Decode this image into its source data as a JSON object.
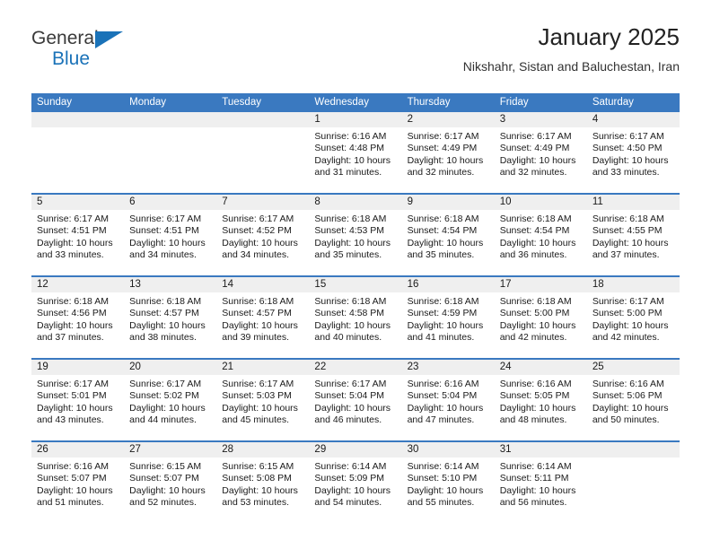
{
  "brand": {
    "name_top": "General",
    "name_bottom": "Blue",
    "logo_color": "#1a72b8",
    "text_color": "#3a3a3a"
  },
  "header": {
    "title": "January 2025",
    "subtitle": "Nikshahr, Sistan and Baluchestan, Iran"
  },
  "theme": {
    "header_bg": "#3a79c0",
    "header_text": "#ffffff",
    "number_band_bg": "#efefef",
    "cell_bg": "#ffffff",
    "divider": "#3a79c0"
  },
  "calendar": {
    "weekdays": [
      "Sunday",
      "Monday",
      "Tuesday",
      "Wednesday",
      "Thursday",
      "Friday",
      "Saturday"
    ],
    "labels": {
      "sunrise": "Sunrise:",
      "sunset": "Sunset:",
      "daylight": "Daylight:"
    },
    "weeks": [
      [
        {
          "day": "",
          "sunrise": "",
          "sunset": "",
          "daylight_line1": "",
          "daylight_line2": ""
        },
        {
          "day": "",
          "sunrise": "",
          "sunset": "",
          "daylight_line1": "",
          "daylight_line2": ""
        },
        {
          "day": "",
          "sunrise": "",
          "sunset": "",
          "daylight_line1": "",
          "daylight_line2": ""
        },
        {
          "day": "1",
          "sunrise": "Sunrise: 6:16 AM",
          "sunset": "Sunset: 4:48 PM",
          "daylight_line1": "Daylight: 10 hours",
          "daylight_line2": "and 31 minutes."
        },
        {
          "day": "2",
          "sunrise": "Sunrise: 6:17 AM",
          "sunset": "Sunset: 4:49 PM",
          "daylight_line1": "Daylight: 10 hours",
          "daylight_line2": "and 32 minutes."
        },
        {
          "day": "3",
          "sunrise": "Sunrise: 6:17 AM",
          "sunset": "Sunset: 4:49 PM",
          "daylight_line1": "Daylight: 10 hours",
          "daylight_line2": "and 32 minutes."
        },
        {
          "day": "4",
          "sunrise": "Sunrise: 6:17 AM",
          "sunset": "Sunset: 4:50 PM",
          "daylight_line1": "Daylight: 10 hours",
          "daylight_line2": "and 33 minutes."
        }
      ],
      [
        {
          "day": "5",
          "sunrise": "Sunrise: 6:17 AM",
          "sunset": "Sunset: 4:51 PM",
          "daylight_line1": "Daylight: 10 hours",
          "daylight_line2": "and 33 minutes."
        },
        {
          "day": "6",
          "sunrise": "Sunrise: 6:17 AM",
          "sunset": "Sunset: 4:51 PM",
          "daylight_line1": "Daylight: 10 hours",
          "daylight_line2": "and 34 minutes."
        },
        {
          "day": "7",
          "sunrise": "Sunrise: 6:17 AM",
          "sunset": "Sunset: 4:52 PM",
          "daylight_line1": "Daylight: 10 hours",
          "daylight_line2": "and 34 minutes."
        },
        {
          "day": "8",
          "sunrise": "Sunrise: 6:18 AM",
          "sunset": "Sunset: 4:53 PM",
          "daylight_line1": "Daylight: 10 hours",
          "daylight_line2": "and 35 minutes."
        },
        {
          "day": "9",
          "sunrise": "Sunrise: 6:18 AM",
          "sunset": "Sunset: 4:54 PM",
          "daylight_line1": "Daylight: 10 hours",
          "daylight_line2": "and 35 minutes."
        },
        {
          "day": "10",
          "sunrise": "Sunrise: 6:18 AM",
          "sunset": "Sunset: 4:54 PM",
          "daylight_line1": "Daylight: 10 hours",
          "daylight_line2": "and 36 minutes."
        },
        {
          "day": "11",
          "sunrise": "Sunrise: 6:18 AM",
          "sunset": "Sunset: 4:55 PM",
          "daylight_line1": "Daylight: 10 hours",
          "daylight_line2": "and 37 minutes."
        }
      ],
      [
        {
          "day": "12",
          "sunrise": "Sunrise: 6:18 AM",
          "sunset": "Sunset: 4:56 PM",
          "daylight_line1": "Daylight: 10 hours",
          "daylight_line2": "and 37 minutes."
        },
        {
          "day": "13",
          "sunrise": "Sunrise: 6:18 AM",
          "sunset": "Sunset: 4:57 PM",
          "daylight_line1": "Daylight: 10 hours",
          "daylight_line2": "and 38 minutes."
        },
        {
          "day": "14",
          "sunrise": "Sunrise: 6:18 AM",
          "sunset": "Sunset: 4:57 PM",
          "daylight_line1": "Daylight: 10 hours",
          "daylight_line2": "and 39 minutes."
        },
        {
          "day": "15",
          "sunrise": "Sunrise: 6:18 AM",
          "sunset": "Sunset: 4:58 PM",
          "daylight_line1": "Daylight: 10 hours",
          "daylight_line2": "and 40 minutes."
        },
        {
          "day": "16",
          "sunrise": "Sunrise: 6:18 AM",
          "sunset": "Sunset: 4:59 PM",
          "daylight_line1": "Daylight: 10 hours",
          "daylight_line2": "and 41 minutes."
        },
        {
          "day": "17",
          "sunrise": "Sunrise: 6:18 AM",
          "sunset": "Sunset: 5:00 PM",
          "daylight_line1": "Daylight: 10 hours",
          "daylight_line2": "and 42 minutes."
        },
        {
          "day": "18",
          "sunrise": "Sunrise: 6:17 AM",
          "sunset": "Sunset: 5:00 PM",
          "daylight_line1": "Daylight: 10 hours",
          "daylight_line2": "and 42 minutes."
        }
      ],
      [
        {
          "day": "19",
          "sunrise": "Sunrise: 6:17 AM",
          "sunset": "Sunset: 5:01 PM",
          "daylight_line1": "Daylight: 10 hours",
          "daylight_line2": "and 43 minutes."
        },
        {
          "day": "20",
          "sunrise": "Sunrise: 6:17 AM",
          "sunset": "Sunset: 5:02 PM",
          "daylight_line1": "Daylight: 10 hours",
          "daylight_line2": "and 44 minutes."
        },
        {
          "day": "21",
          "sunrise": "Sunrise: 6:17 AM",
          "sunset": "Sunset: 5:03 PM",
          "daylight_line1": "Daylight: 10 hours",
          "daylight_line2": "and 45 minutes."
        },
        {
          "day": "22",
          "sunrise": "Sunrise: 6:17 AM",
          "sunset": "Sunset: 5:04 PM",
          "daylight_line1": "Daylight: 10 hours",
          "daylight_line2": "and 46 minutes."
        },
        {
          "day": "23",
          "sunrise": "Sunrise: 6:16 AM",
          "sunset": "Sunset: 5:04 PM",
          "daylight_line1": "Daylight: 10 hours",
          "daylight_line2": "and 47 minutes."
        },
        {
          "day": "24",
          "sunrise": "Sunrise: 6:16 AM",
          "sunset": "Sunset: 5:05 PM",
          "daylight_line1": "Daylight: 10 hours",
          "daylight_line2": "and 48 minutes."
        },
        {
          "day": "25",
          "sunrise": "Sunrise: 6:16 AM",
          "sunset": "Sunset: 5:06 PM",
          "daylight_line1": "Daylight: 10 hours",
          "daylight_line2": "and 50 minutes."
        }
      ],
      [
        {
          "day": "26",
          "sunrise": "Sunrise: 6:16 AM",
          "sunset": "Sunset: 5:07 PM",
          "daylight_line1": "Daylight: 10 hours",
          "daylight_line2": "and 51 minutes."
        },
        {
          "day": "27",
          "sunrise": "Sunrise: 6:15 AM",
          "sunset": "Sunset: 5:07 PM",
          "daylight_line1": "Daylight: 10 hours",
          "daylight_line2": "and 52 minutes."
        },
        {
          "day": "28",
          "sunrise": "Sunrise: 6:15 AM",
          "sunset": "Sunset: 5:08 PM",
          "daylight_line1": "Daylight: 10 hours",
          "daylight_line2": "and 53 minutes."
        },
        {
          "day": "29",
          "sunrise": "Sunrise: 6:14 AM",
          "sunset": "Sunset: 5:09 PM",
          "daylight_line1": "Daylight: 10 hours",
          "daylight_line2": "and 54 minutes."
        },
        {
          "day": "30",
          "sunrise": "Sunrise: 6:14 AM",
          "sunset": "Sunset: 5:10 PM",
          "daylight_line1": "Daylight: 10 hours",
          "daylight_line2": "and 55 minutes."
        },
        {
          "day": "31",
          "sunrise": "Sunrise: 6:14 AM",
          "sunset": "Sunset: 5:11 PM",
          "daylight_line1": "Daylight: 10 hours",
          "daylight_line2": "and 56 minutes."
        },
        {
          "day": "",
          "sunrise": "",
          "sunset": "",
          "daylight_line1": "",
          "daylight_line2": ""
        }
      ]
    ]
  }
}
